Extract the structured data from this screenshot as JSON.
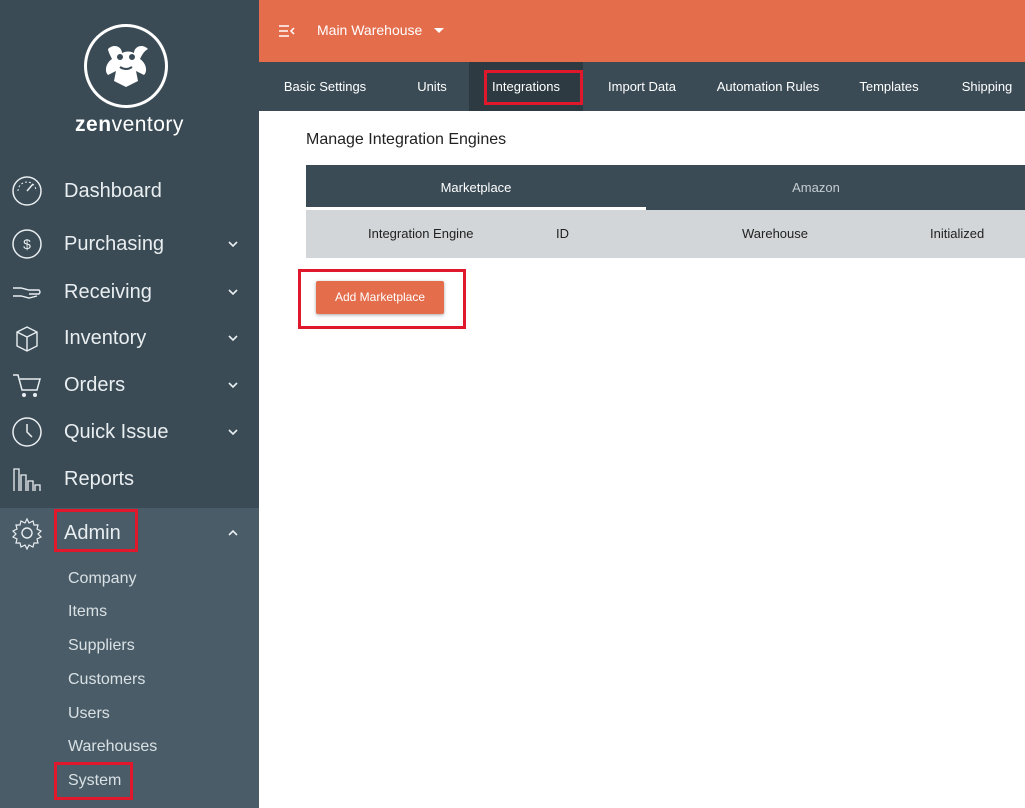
{
  "brand": {
    "prefix": "zen",
    "suffix": "ventory"
  },
  "sidebar": {
    "items": [
      {
        "label": "Dashboard",
        "icon": "speedometer-icon"
      },
      {
        "label": "Purchasing",
        "icon": "dollar-circle-icon"
      },
      {
        "label": "Receiving",
        "icon": "hand-icon"
      },
      {
        "label": "Inventory",
        "icon": "box-icon"
      },
      {
        "label": "Orders",
        "icon": "cart-icon"
      },
      {
        "label": "Quick Issue",
        "icon": "clock-icon"
      },
      {
        "label": "Reports",
        "icon": "bar-chart-icon"
      },
      {
        "label": "Admin",
        "icon": "gear-icon"
      }
    ],
    "admin_sub": [
      "Company",
      "Items",
      "Suppliers",
      "Customers",
      "Users",
      "Warehouses",
      "System"
    ]
  },
  "topbar": {
    "warehouse": "Main Warehouse"
  },
  "tabs": [
    "Basic Settings",
    "Units",
    "Integrations",
    "Import Data",
    "Automation Rules",
    "Templates",
    "Shipping"
  ],
  "main": {
    "title": "Manage Integration Engines",
    "table_tabs": [
      "Marketplace",
      "Amazon"
    ],
    "columns": [
      "Integration Engine",
      "ID",
      "Warehouse",
      "Initialized"
    ],
    "add_button": "Add Marketplace"
  },
  "colors": {
    "accent": "#e46d4c",
    "sidebar": "#3a4b55",
    "highlight": "#e0182b"
  }
}
